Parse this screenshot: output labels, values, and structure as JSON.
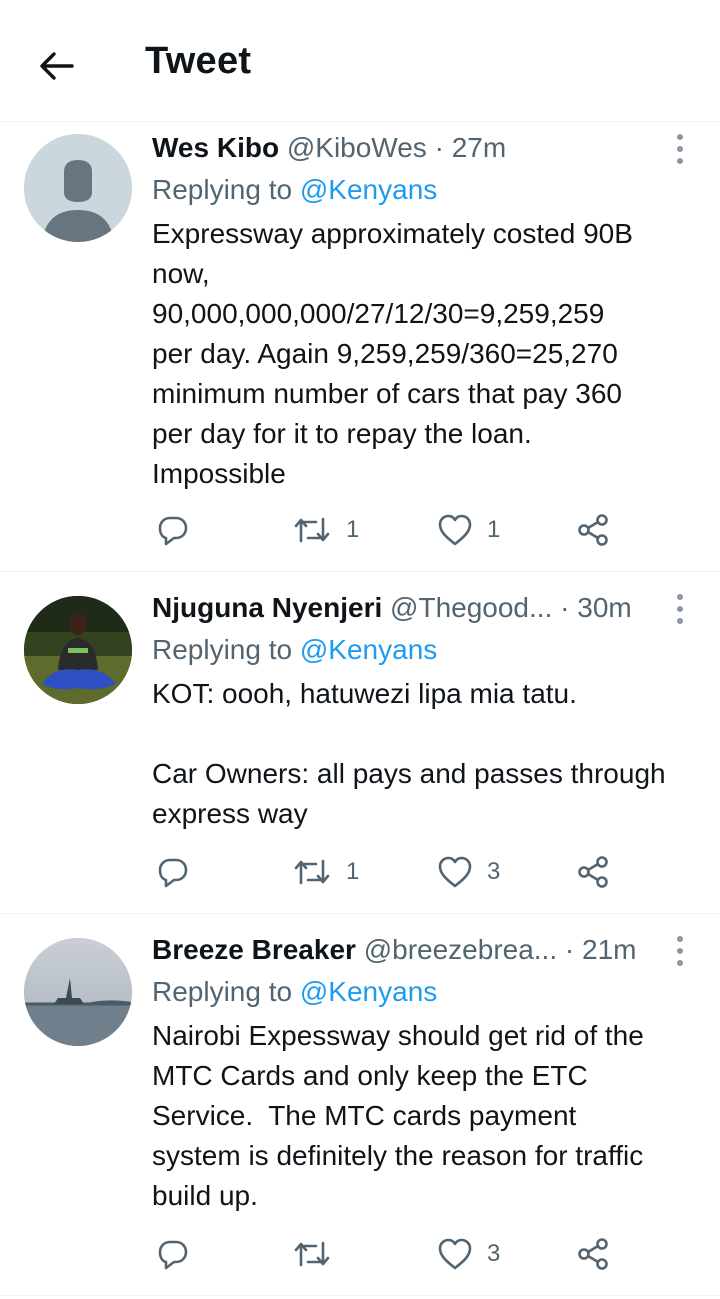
{
  "header": {
    "title": "Tweet"
  },
  "tweets": [
    {
      "name": "Wes Kibo",
      "handle": "@KiboWes",
      "separator": "·",
      "time": "27m",
      "replying_prefix": "Replying to",
      "replying_to": "@Kenyans",
      "text": "Expressway approximately costed 90B\nnow,\n90,000,000,000/27/12/30=9,259,259\nper day. Again 9,259,259/360=25,270\nminimum number of cars that pay 360\nper day for it to repay the loan.\nImpossible",
      "retweets": "1",
      "likes": "1",
      "avatar": "default-avatar"
    },
    {
      "name": "Njuguna Nyenjeri",
      "handle": "@Thegood...",
      "separator": "·",
      "time": "30m",
      "replying_prefix": "Replying to",
      "replying_to": "@Kenyans",
      "text": "KOT: oooh, hatuwezi lipa mia tatu.\n\nCar Owners: all pays and passes through\nexpress way",
      "retweets": "1",
      "likes": "3",
      "avatar": "photo-man-seated-on-grass"
    },
    {
      "name": "Breeze Breaker",
      "handle": "@breezebrea...",
      "separator": "·",
      "time": "21m",
      "replying_prefix": "Replying to",
      "replying_to": "@Kenyans",
      "text": "Nairobi Expessway should get rid of the\nMTC Cards and only keep the ETC\nService.  The MTC cards payment\nsystem is definitely the reason for traffic\nbuild up.",
      "retweets": "",
      "likes": "3",
      "avatar": "photo-statue-of-liberty"
    }
  ],
  "colors": {
    "text": "#0f1419",
    "muted": "#536471",
    "link": "#1d9bf0",
    "divider": "#eff3f4"
  },
  "icons": [
    "back-arrow-icon",
    "more-vertical-icon",
    "reply-icon",
    "retweet-icon",
    "like-icon",
    "share-icon"
  ]
}
